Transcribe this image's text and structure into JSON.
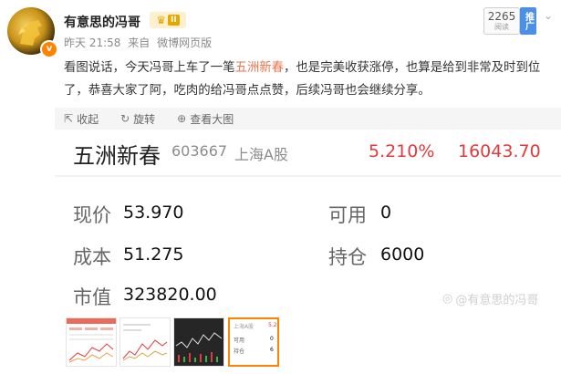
{
  "author": {
    "name": "有意思的冯哥",
    "vip_level": "II",
    "verified_mark": "v"
  },
  "meta": {
    "time": "昨天 21:58",
    "source_prefix": "来自",
    "source": "微博网页版"
  },
  "read_badge": {
    "count": "2265",
    "label": "阅读"
  },
  "promo_tag": "推广",
  "post": {
    "text_before": "看图说话，今天冯哥上车了一笔",
    "highlight": "五洲新春",
    "text_after": "，也是完美收获涨停，也算是给到非常及时到位了，恭喜大家了阿，吃肉的给冯哥点点赞，后续冯哥也会继续分享。"
  },
  "toolbar": {
    "collect": "收起",
    "rotate": "旋转",
    "view_large": "查看大图"
  },
  "stock": {
    "name": "五洲新春",
    "code": "603667",
    "market": "上海A股",
    "change_pct": "5.210%",
    "value": "16043.70",
    "fields": {
      "price_label": "现价",
      "price": "53.970",
      "cost_label": "成本",
      "cost": "51.275",
      "mkt_label": "市值",
      "mkt": "323820.00",
      "avail_label": "可用",
      "avail": "0",
      "hold_label": "持仓",
      "hold": "6000"
    },
    "watermark": "@有意思的冯哥"
  },
  "thumbnails": {
    "selected_index": 3,
    "t4": {
      "l1": "上海A股",
      "l2": "可用",
      "l3": "持仓",
      "v0": "5.2",
      "v1": "0",
      "v2": "6"
    }
  },
  "colors": {
    "highlight": "#eb7350",
    "stock_red": "#e4393c",
    "selected_border": "#ff8200"
  }
}
